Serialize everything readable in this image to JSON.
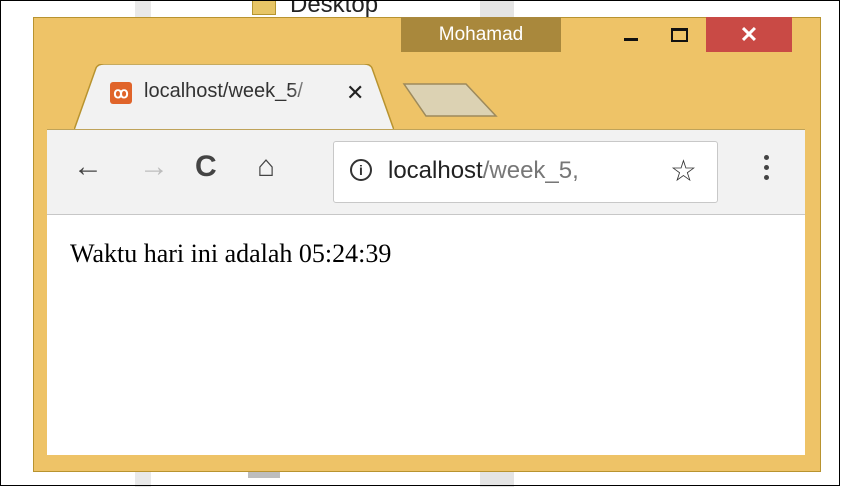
{
  "background": {
    "folder_label": "Desktop"
  },
  "window": {
    "profile_name": "Mohamad",
    "controls": {
      "minimize": "minimize",
      "maximize": "maximize",
      "close_glyph": "✕"
    },
    "colors": {
      "frame": "#eec367",
      "profile_badge": "#a9883c",
      "close": "#c94a45",
      "favicon": "#e0642a"
    }
  },
  "tab": {
    "favicon": "xampp-icon",
    "title": "localhost/week_5/",
    "close_glyph": "✕"
  },
  "toolbar": {
    "back_glyph": "←",
    "forward_glyph": "→",
    "reload_glyph": "C",
    "home_glyph": "⌂",
    "info_glyph": "i",
    "url_host": "localhost",
    "url_path": "/week_5,",
    "star_glyph": "☆"
  },
  "content": {
    "text": "Waktu hari ini adalah 05:24:39"
  }
}
